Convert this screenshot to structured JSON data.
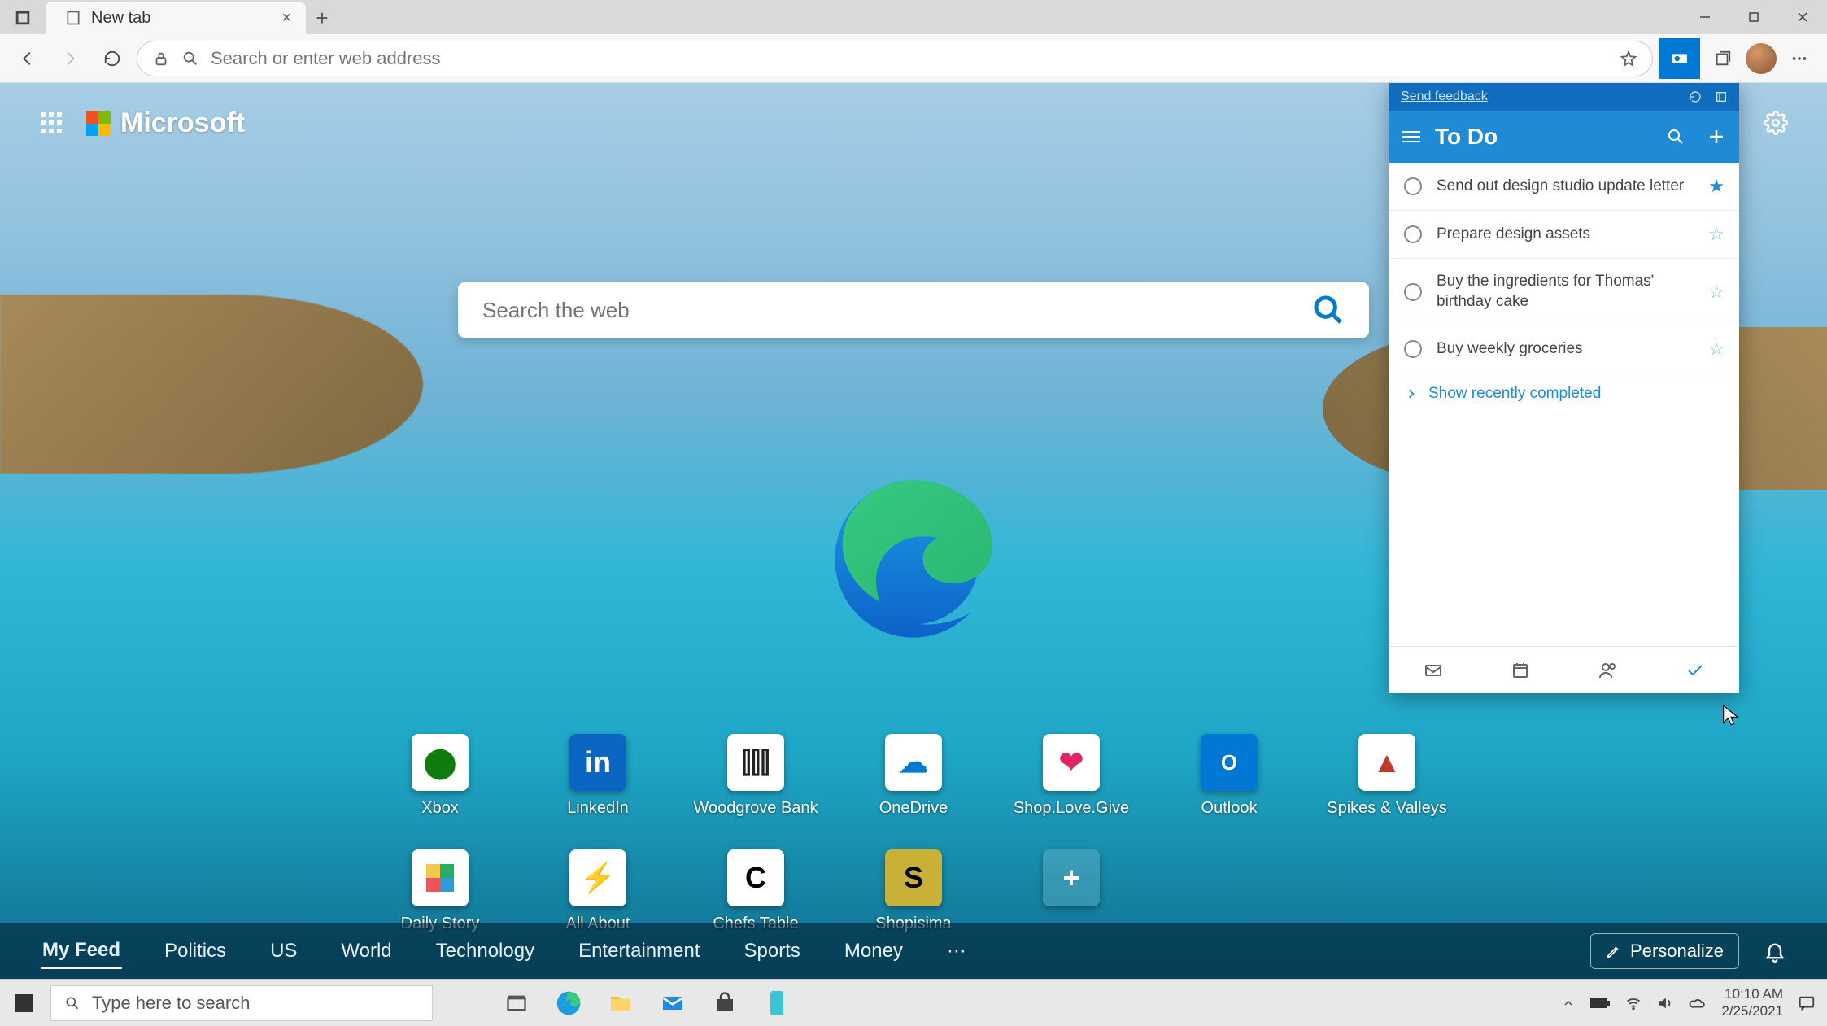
{
  "tab": {
    "title": "New tab"
  },
  "toolbar": {
    "address_placeholder": "Search or enter web address"
  },
  "brand": {
    "name": "Microsoft"
  },
  "search": {
    "placeholder": "Search the web"
  },
  "tiles": {
    "row1": [
      {
        "label": "Xbox"
      },
      {
        "label": "LinkedIn"
      },
      {
        "label": "Woodgrove Bank"
      },
      {
        "label": "OneDrive"
      },
      {
        "label": "Shop.Love.Give"
      },
      {
        "label": "Outlook"
      },
      {
        "label": "Spikes & Valleys"
      }
    ],
    "row2": [
      {
        "label": "Daily Story"
      },
      {
        "label": "All About"
      },
      {
        "label": "Chefs Table"
      },
      {
        "label": "Shopisima"
      }
    ]
  },
  "feed": {
    "tabs": [
      "My Feed",
      "Politics",
      "US",
      "World",
      "Technology",
      "Entertainment",
      "Sports",
      "Money"
    ],
    "personalize": "Personalize"
  },
  "panel": {
    "feedback": "Send feedback",
    "title": "To Do",
    "tasks": [
      {
        "text": "Send out design studio update letter",
        "starred": true
      },
      {
        "text": "Prepare design assets",
        "starred": false
      },
      {
        "text": "Buy the ingredients for Thomas' birthday cake",
        "starred": false
      },
      {
        "text": "Buy weekly groceries",
        "starred": false
      }
    ],
    "show_completed": "Show recently completed"
  },
  "taskbar": {
    "search_placeholder": "Type here to search",
    "time": "10:10 AM",
    "date": "2/25/2021"
  }
}
